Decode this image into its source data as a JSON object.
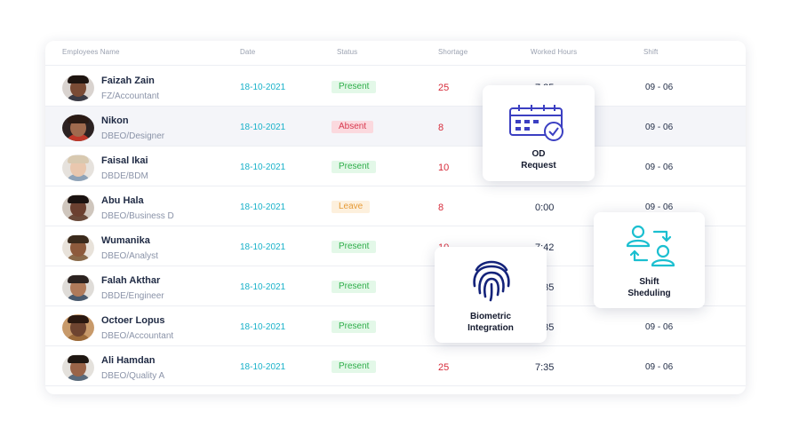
{
  "table": {
    "headers": {
      "name": "Employees Name",
      "date": "Date",
      "status": "Status",
      "shortage": "Shortage",
      "worked": "Worked Hours",
      "shift": "Shift"
    },
    "rows": [
      {
        "name": "Faizah Zain",
        "role": "FZ/Accountant",
        "date": "18-10-2021",
        "status": "Present",
        "status_type": "present",
        "shortage": "25",
        "worked": "7:35",
        "shift": "09 - 06"
      },
      {
        "name": "Nikon",
        "role": "DBEO/Designer",
        "date": "18-10-2021",
        "status": "Absent",
        "status_type": "absent",
        "shortage": "8",
        "worked": "",
        "shift": "09 - 06"
      },
      {
        "name": "Faisal Ikai",
        "role": "DBDE/BDM",
        "date": "18-10-2021",
        "status": "Present",
        "status_type": "present",
        "shortage": "10",
        "worked": "",
        "shift": "09 - 06"
      },
      {
        "name": "Abu Hala",
        "role": "DBEO/Business D",
        "date": "18-10-2021",
        "status": "Leave",
        "status_type": "leave",
        "shortage": "8",
        "worked": "0:00",
        "shift": "09 - 06"
      },
      {
        "name": "Wumanika",
        "role": "DBEO/Analyst",
        "date": "18-10-2021",
        "status": "Present",
        "status_type": "present",
        "shortage": "10",
        "worked": "7:42",
        "shift": ""
      },
      {
        "name": "Falah Akthar",
        "role": "DBDE/Engineer",
        "date": "18-10-2021",
        "status": "Present",
        "status_type": "present",
        "shortage": "",
        "worked": "7:35",
        "shift": ""
      },
      {
        "name": "Octoer Lopus",
        "role": "DBEO/Accountant",
        "date": "18-10-2021",
        "status": "Present",
        "status_type": "present",
        "shortage": "",
        "worked": "7:35",
        "shift": "09 - 06"
      },
      {
        "name": "Ali Hamdan",
        "role": "DBEO/Quality A",
        "date": "18-10-2021",
        "status": "Present",
        "status_type": "present",
        "shortage": "25",
        "worked": "7:35",
        "shift": "09 - 06"
      }
    ]
  },
  "popups": {
    "od": {
      "line1": "OD",
      "line2": "Request",
      "icon": "calendar-check-icon"
    },
    "biometric": {
      "line1": "Biometric",
      "line2": "Integration",
      "icon": "fingerprint-icon"
    },
    "shift": {
      "line1": "Shift",
      "line2": "Sheduling",
      "icon": "user-swap-icon"
    }
  },
  "colors": {
    "accent": "#16b1c9",
    "brand_blue": "#3b3fc2",
    "icon_navy": "#14237a",
    "icon_teal": "#1bbfd0",
    "shortage_red": "#d72b3a"
  }
}
